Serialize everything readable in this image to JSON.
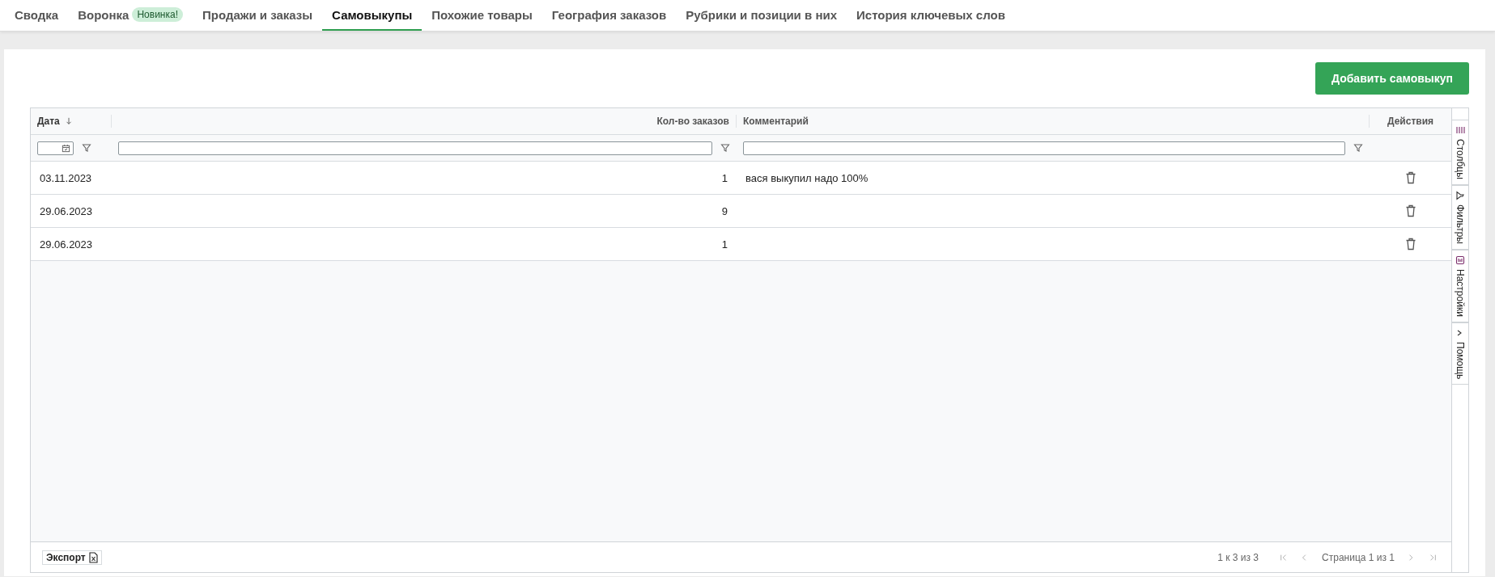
{
  "tabs": [
    {
      "label": "Сводка",
      "selected": false
    },
    {
      "label": "Воронка",
      "selected": false,
      "badge": "Новинка!"
    },
    {
      "label": "Продажи и заказы",
      "selected": false
    },
    {
      "label": "Самовыкупы",
      "selected": true
    },
    {
      "label": "Похожие товары",
      "selected": false
    },
    {
      "label": "География заказов",
      "selected": false
    },
    {
      "label": "Рубрики и позиции в них",
      "selected": false
    },
    {
      "label": "История ключевых слов",
      "selected": false
    }
  ],
  "add_button": "Добавить самовыкуп",
  "table": {
    "columns": [
      {
        "label": "Дата",
        "sorted": true,
        "kind": "date"
      },
      {
        "label": "Кол-во заказов",
        "sorted": false,
        "kind": "number"
      },
      {
        "label": "Комментарий",
        "sorted": false,
        "kind": "text"
      },
      {
        "label": "Действия",
        "sorted": false,
        "kind": "actions"
      }
    ],
    "rows": [
      {
        "date": "03.11.2023",
        "orders": "1",
        "comment": "вася выкупил надо 100%"
      },
      {
        "date": "29.06.2023",
        "orders": "9"
      },
      {
        "date": "29.06.2023",
        "orders": "1"
      }
    ]
  },
  "side_panel": [
    {
      "label": "Столбцы",
      "kind": "columns"
    },
    {
      "label": "Фильтры",
      "kind": "filter"
    },
    {
      "label": "Настройки",
      "kind": "settings"
    },
    {
      "label": "Помощь",
      "kind": "help"
    }
  ],
  "footer": {
    "export": "Экспорт",
    "row_summary": "1 к 3 из 3",
    "page_label": "Страница 1 из 1"
  }
}
